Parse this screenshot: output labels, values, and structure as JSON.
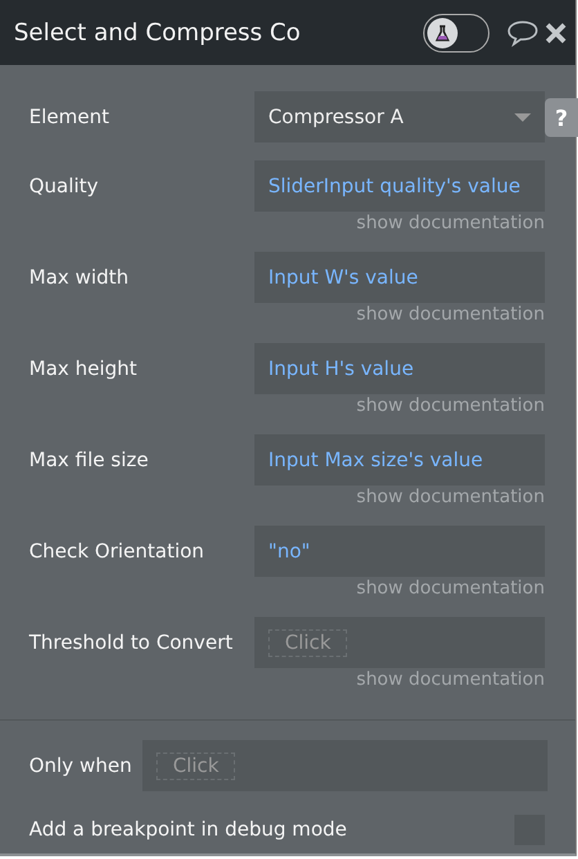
{
  "window": {
    "title": "Select and Compress Co",
    "test_mode_on": false
  },
  "properties": [
    {
      "label": "Element",
      "kind": "dropdown",
      "value": "Compressor A"
    },
    {
      "label": "Quality",
      "kind": "expression",
      "value": "SliderInput quality's value",
      "doc": "show documentation"
    },
    {
      "label": "Max width",
      "kind": "expression",
      "value": "Input W's value",
      "doc": "show documentation"
    },
    {
      "label": "Max height",
      "kind": "expression",
      "value": "Input H's value",
      "doc": "show documentation"
    },
    {
      "label": "Max file size",
      "kind": "expression",
      "value": "Input Max size's value",
      "doc": "show documentation"
    },
    {
      "label": "Check Orientation",
      "kind": "expression",
      "value": "\"no\"",
      "doc": "show documentation"
    },
    {
      "label": "Threshold to Convert",
      "kind": "empty",
      "placeholder": "Click",
      "doc": "show documentation"
    }
  ],
  "help": "?",
  "only_when": {
    "label": "Only when",
    "placeholder": "Click"
  },
  "breakpoint": {
    "label": "Add a breakpoint in debug mode",
    "checked": false
  }
}
